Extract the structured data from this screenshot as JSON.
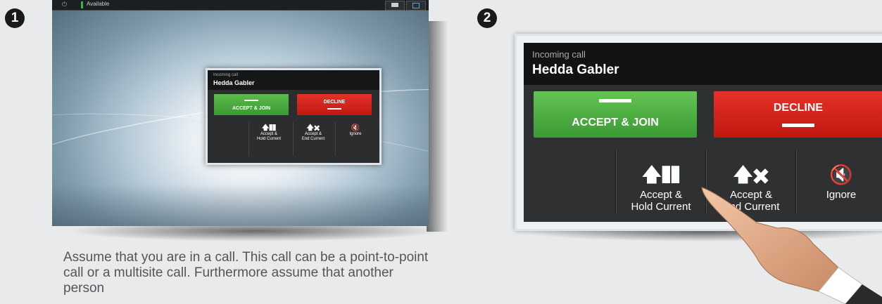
{
  "steps": [
    "1",
    "2"
  ],
  "panel1": {
    "topbar": {
      "power_icon": "power-icon",
      "status": "Available",
      "buttons": [
        "camera-icon",
        "share-screen-icon"
      ]
    },
    "dialog": {
      "label": "Incoming call",
      "caller": "Hedda Gabler",
      "accept_join": "ACCEPT & JOIN",
      "decline": "DECLINE",
      "options": [
        {
          "icon": "accept-hold-icon",
          "line1": "Accept &",
          "line2": "Hold Current"
        },
        {
          "icon": "accept-end-icon",
          "line1": "Accept &",
          "line2": "End Current"
        },
        {
          "icon": "ignore-icon",
          "line1": "Ignore",
          "line2": ""
        }
      ]
    },
    "caption": "Assume that you are in a call. This call can be a point-to-point call or a multisite call. Furthermore assume that another person"
  },
  "panel2": {
    "dialog": {
      "label": "Incoming call",
      "caller": "Hedda Gabler",
      "accept_join": "ACCEPT & JOIN",
      "decline": "DECLINE",
      "options": [
        {
          "icon": "accept-hold-icon",
          "line1": "Accept &",
          "line2": "Hold Current"
        },
        {
          "icon": "accept-end-icon",
          "line1": "Accept &",
          "line2": "End Current"
        },
        {
          "icon": "ignore-icon",
          "line1": "Ignore",
          "line2": ""
        }
      ]
    }
  },
  "colors": {
    "accept": "#4caf44",
    "decline": "#d9261f",
    "status": "#3bb54a"
  }
}
